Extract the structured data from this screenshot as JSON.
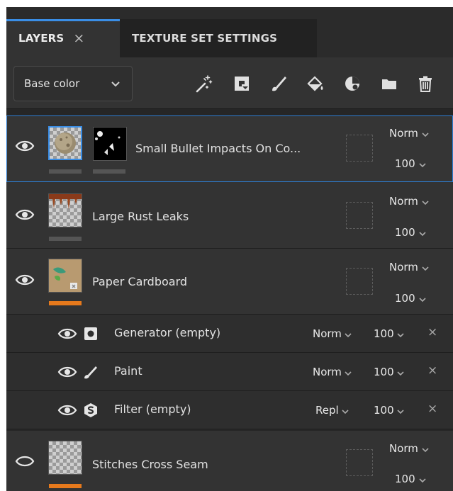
{
  "tabs": {
    "layers": {
      "label": "LAYERS",
      "close": "×"
    },
    "texture_set": {
      "label": "TEXTURE SET SETTINGS"
    }
  },
  "toolbar": {
    "channel": "Base color",
    "tools": [
      "magic-wand-icon",
      "smart-material-icon",
      "paint-brush-icon",
      "fill-bucket-icon",
      "smart-mask-icon",
      "folder-icon",
      "trash-icon"
    ]
  },
  "layers": [
    {
      "name": "Small Bullet Impacts On Co...",
      "blend": "Norm",
      "opacity": "100",
      "selected": true
    },
    {
      "name": "Large Rust Leaks",
      "blend": "Norm",
      "opacity": "100"
    },
    {
      "name": "Paper Cardboard",
      "blend": "Norm",
      "opacity": "100"
    },
    {
      "name": "Stitches Cross Seam",
      "blend": "Norm",
      "opacity": "100"
    }
  ],
  "effects": [
    {
      "name": "Generator (empty)",
      "icon": "generator-icon",
      "blend": "Norm",
      "opacity": "100",
      "close": "×"
    },
    {
      "name": "Paint",
      "icon": "paint-brush-icon",
      "blend": "Norm",
      "opacity": "100",
      "close": "×"
    },
    {
      "name": "Filter (empty)",
      "icon": "filter-icon",
      "blend": "Repl",
      "opacity": "100",
      "close": "×"
    }
  ],
  "colors": {
    "accent": "#3a8ee6",
    "orange": "#e6791c",
    "panel": "#333333"
  }
}
